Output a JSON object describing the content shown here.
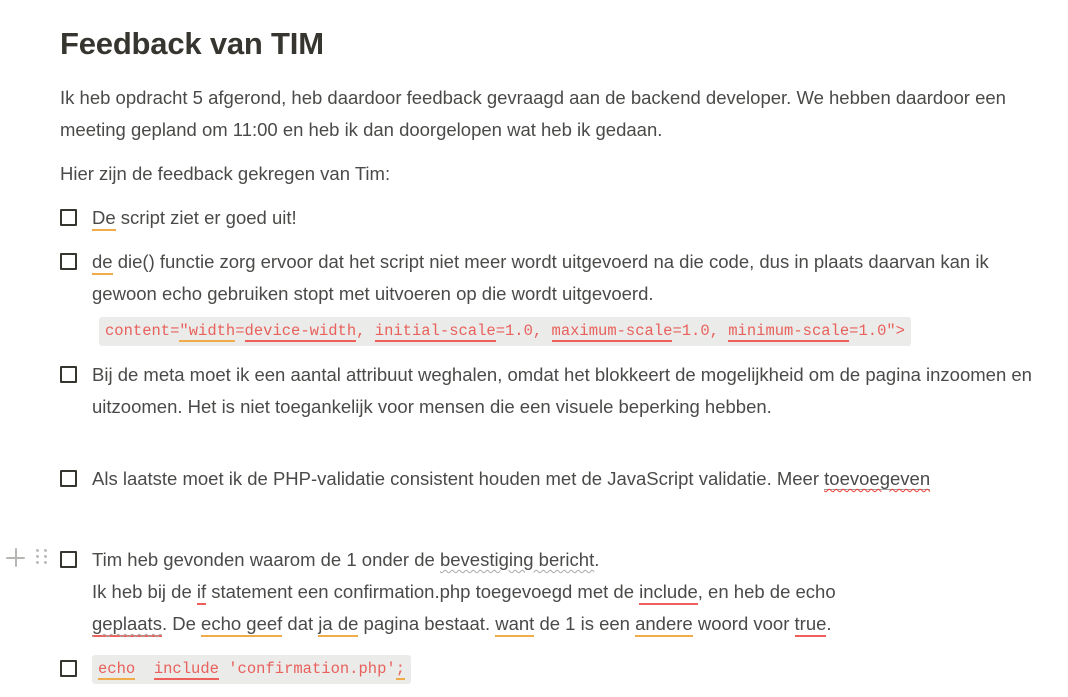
{
  "document": {
    "title": "Feedback van TIM",
    "intro_paragraph": "Ik heb opdracht 5 afgerond, heb daardoor feedback gevraagd aan de backend developer. We hebben daardoor een meeting gepland om 11:00 en heb ik dan doorgelopen wat heb ik gedaan.",
    "lead_in": "Hier zijn de feedback gekregen van Tim:"
  },
  "checklist": [
    {
      "id": "item-1",
      "checked": false,
      "text_full": "De script ziet er goed uit!",
      "parts": {
        "flagged_word": "De",
        "rest": " script ziet er goed uit!"
      }
    },
    {
      "id": "item-2",
      "checked": false,
      "text_full": "de  die() functie zorg ervoor dat het script niet meer wordt uitgevoerd na die code, dus in plaats daarvan kan ik gewoon echo gebruiken  stopt met uitvoeren op die wordt uitgevoerd.",
      "parts": {
        "flagged_word": "de",
        "rest": "  die() functie zorg ervoor dat het script niet meer wordt uitgevoerd na die code, dus in plaats daarvan kan ik gewoon echo gebruiken  stopt met uitvoeren op die wordt uitgevoerd."
      }
    },
    {
      "id": "item-3",
      "checked": false,
      "text_full": "Bij de meta moet ik een aantal attribuut weghalen, omdat het blokkeert de mogelijkheid om de pagina inzoomen en uitzoomen. Het is niet toegankelijk voor mensen die een visuele beperking hebben."
    },
    {
      "id": "item-4",
      "checked": false,
      "parts": {
        "line_1": "Als laatste moet ik de PHP-validatie consistent houden met de JavaScript validatie. Meer ",
        "flagged_word": "toevoegeven"
      }
    },
    {
      "id": "item-5",
      "checked": false,
      "line_1": {
        "before": "Tim heb gevonden waarom de 1 onder de ",
        "flagged_phrase": "bevestiging  bericht",
        "after": "."
      },
      "line_2": {
        "s1": "Ik heb bij de ",
        "w1": "if",
        "s2": " statement een confirmation.php toegevoegd met de ",
        "w2": "include",
        "s3": ", en heb de echo"
      },
      "line_3": {
        "w3": "geplaats",
        "s4": ". De ",
        "w4": "echo geef",
        "s5": " dat ",
        "w5": "ja de",
        "s6": " pagina bestaat. ",
        "w6": "want",
        "s7": " de 1 is een ",
        "w7": "andere",
        "s8": " woord voor ",
        "w8": "true",
        "s9": "."
      }
    },
    {
      "id": "item-6",
      "checked": false,
      "is_code": true
    }
  ],
  "code_blocks": {
    "meta_viewport": {
      "s0": "content=",
      "w0": "\"width",
      "s1": "=",
      "w1": "device-width",
      "s2": ", ",
      "w2": "initial-scale",
      "s3": "=1.0, ",
      "w3": "maximum-scale",
      "s4": "=1.0, ",
      "w4": "minimum-scale",
      "s5": "=1.0\">"
    },
    "echo_include": {
      "w0": "echo",
      "s1": "  ",
      "w1": "include",
      "s2": " 'confirmation.php'",
      "w2": ";"
    }
  },
  "gutter": {
    "add_block_label": "+",
    "drag_handle_label": "drag"
  },
  "colors": {
    "text": "#4a4a48",
    "title": "#37352f",
    "code_text": "#e8615c",
    "code_bg": "#ebebea",
    "grammar_orange": "#f0ab4a",
    "grammar_red": "#ee5f5c",
    "spell_red": "#ee3b36",
    "spell_gray": "#a9a9a6",
    "gutter_icon": "#b6b6b3"
  }
}
